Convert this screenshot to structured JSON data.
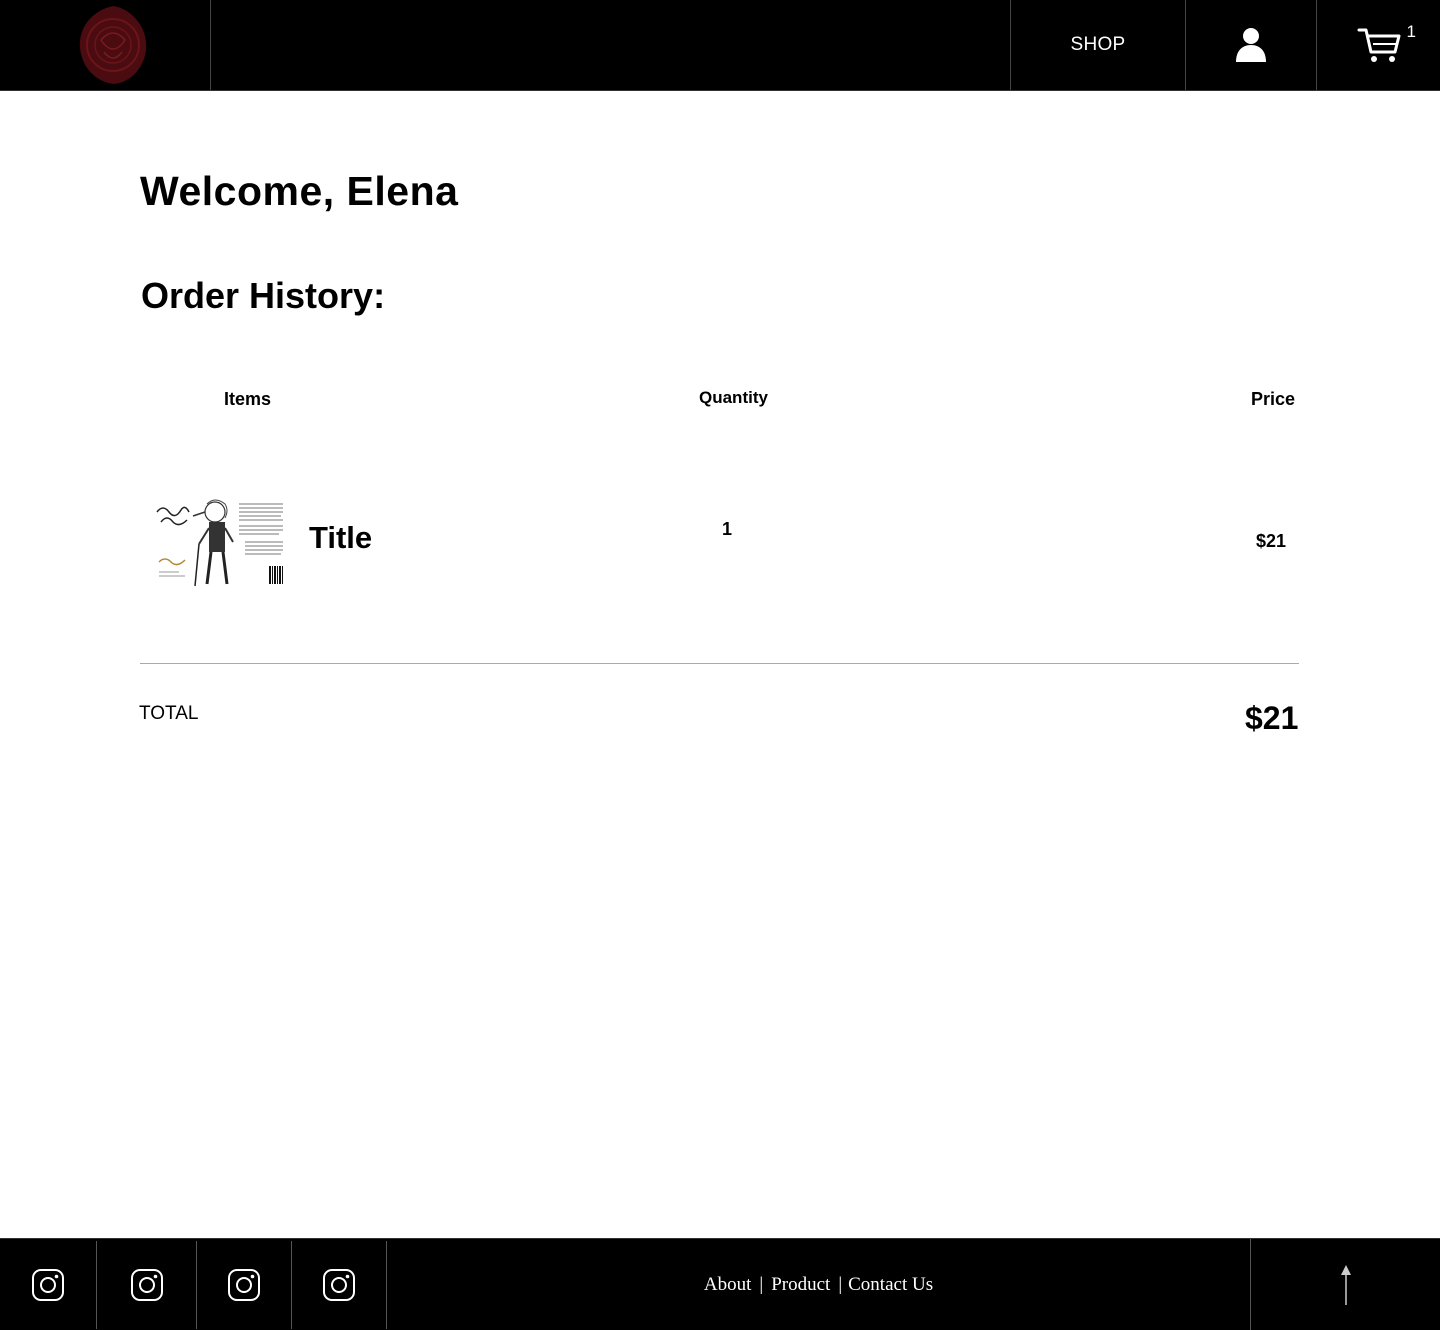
{
  "header": {
    "logo_icon": "wine-seal-logo",
    "nav_shop": "SHOP",
    "account_icon": "user-icon",
    "cart_icon": "cart-icon",
    "cart_count": "1"
  },
  "main": {
    "welcome": "Welcome, Elena",
    "order_history_title": "Order History:",
    "columns": {
      "items": "Items",
      "quantity": "Quantity",
      "price": "Price"
    },
    "orders": [
      {
        "thumbnail_icon": "wine-label-thumbnail",
        "title": "Title",
        "quantity": "1",
        "price": "$21"
      }
    ],
    "total_label": "TOTAL",
    "total_value": "$21"
  },
  "footer": {
    "social_icons": [
      "instagram-icon",
      "instagram-icon",
      "instagram-icon",
      "instagram-icon"
    ],
    "links": {
      "about": "About",
      "product": "Product",
      "contact": "Contact Us"
    },
    "separator": "|",
    "back_to_top_icon": "arrow-up-icon"
  },
  "colors": {
    "header_bg": "#000000",
    "footer_bg": "#000000",
    "logo_accent": "#5a0f14",
    "text": "#000000"
  }
}
